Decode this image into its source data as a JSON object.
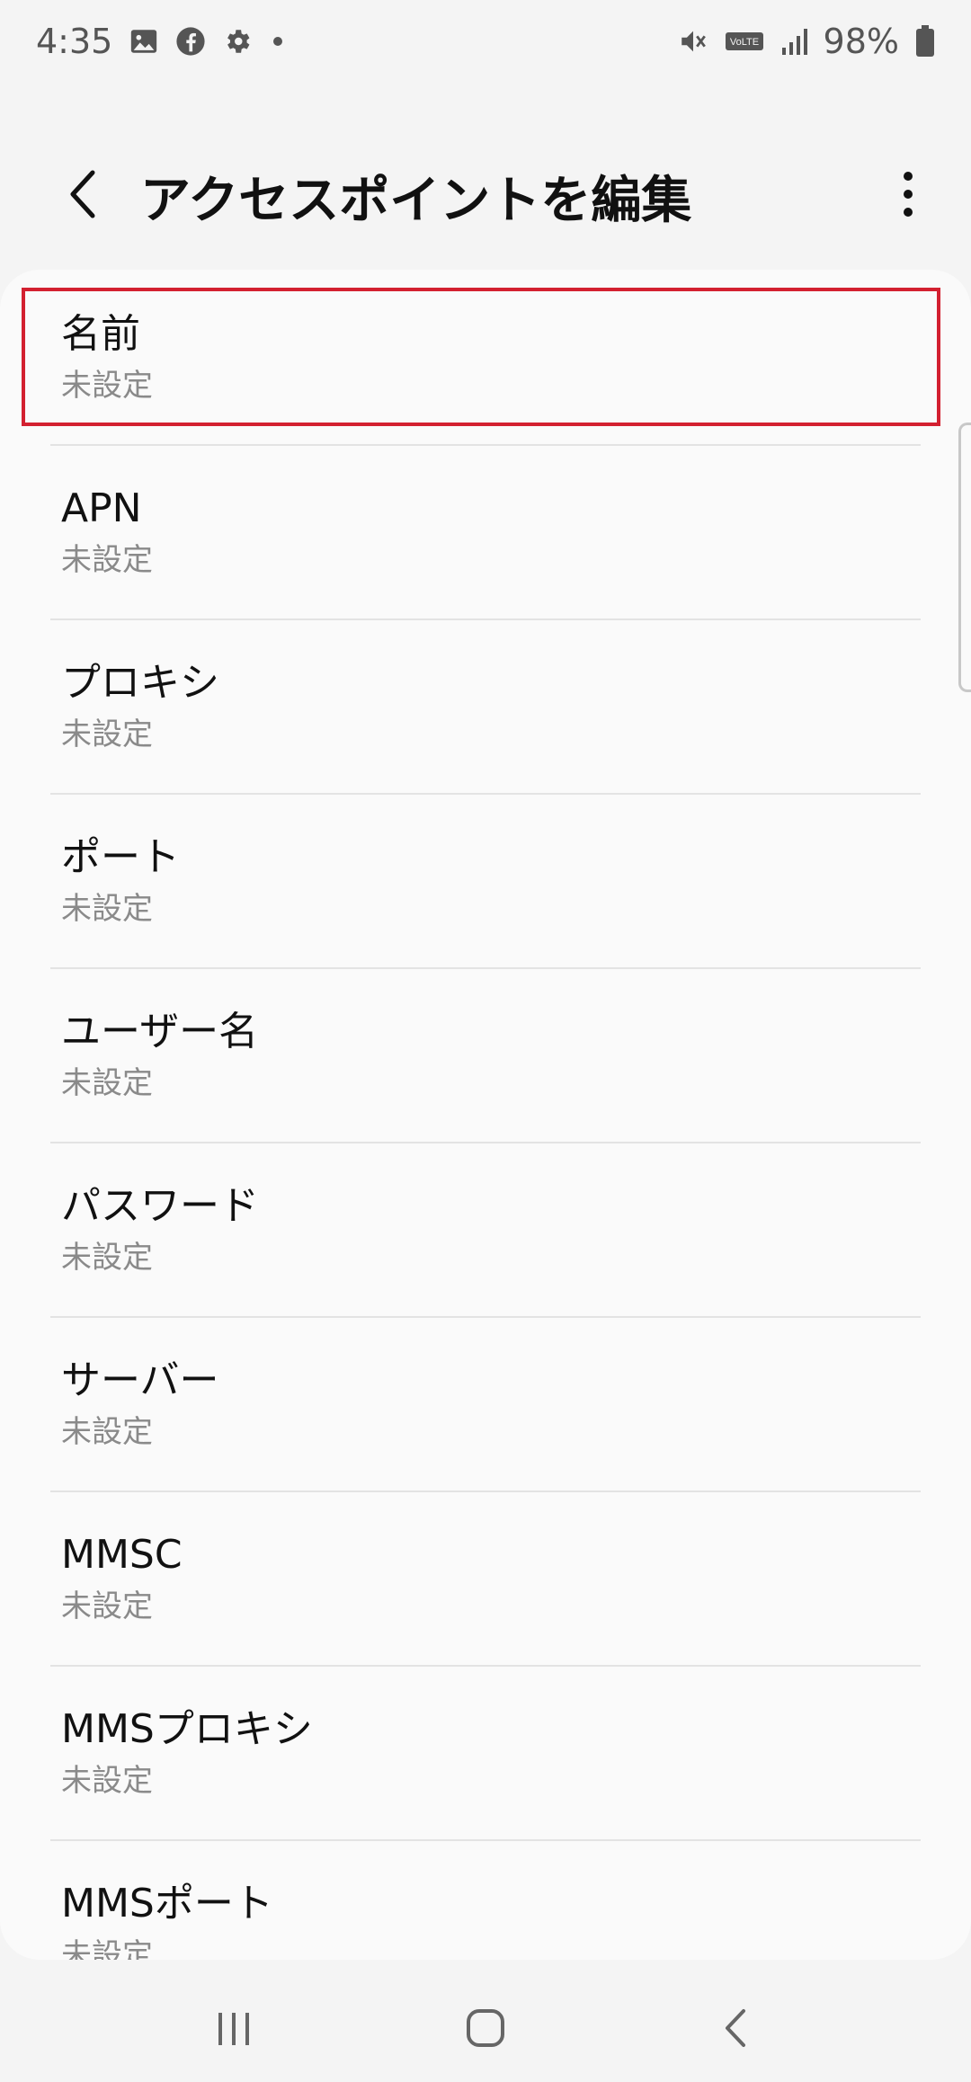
{
  "status_bar": {
    "time": "4:35",
    "battery": "98%",
    "icons_left": [
      "gallery-icon",
      "facebook-icon",
      "settings-gear-icon",
      "dot-icon"
    ],
    "icons_right": [
      "mute-icon",
      "volte-icon",
      "signal-icon",
      "battery-icon"
    ],
    "volte_label": "VoLTE"
  },
  "app_bar": {
    "title": "アクセスポイントを編集"
  },
  "list": {
    "items": [
      {
        "title": "名前",
        "value": "未設定"
      },
      {
        "title": "APN",
        "value": "未設定"
      },
      {
        "title": "プロキシ",
        "value": "未設定"
      },
      {
        "title": "ポート",
        "value": "未設定"
      },
      {
        "title": "ユーザー名",
        "value": "未設定"
      },
      {
        "title": "パスワード",
        "value": "未設定"
      },
      {
        "title": "サーバー",
        "value": "未設定"
      },
      {
        "title": "MMSC",
        "value": "未設定"
      },
      {
        "title": "MMSプロキシ",
        "value": "未設定"
      },
      {
        "title": "MMSポート",
        "value": "未設定"
      }
    ]
  },
  "colors": {
    "highlight": "#d32030",
    "background": "#f4f4f4",
    "card": "#fafafa"
  }
}
